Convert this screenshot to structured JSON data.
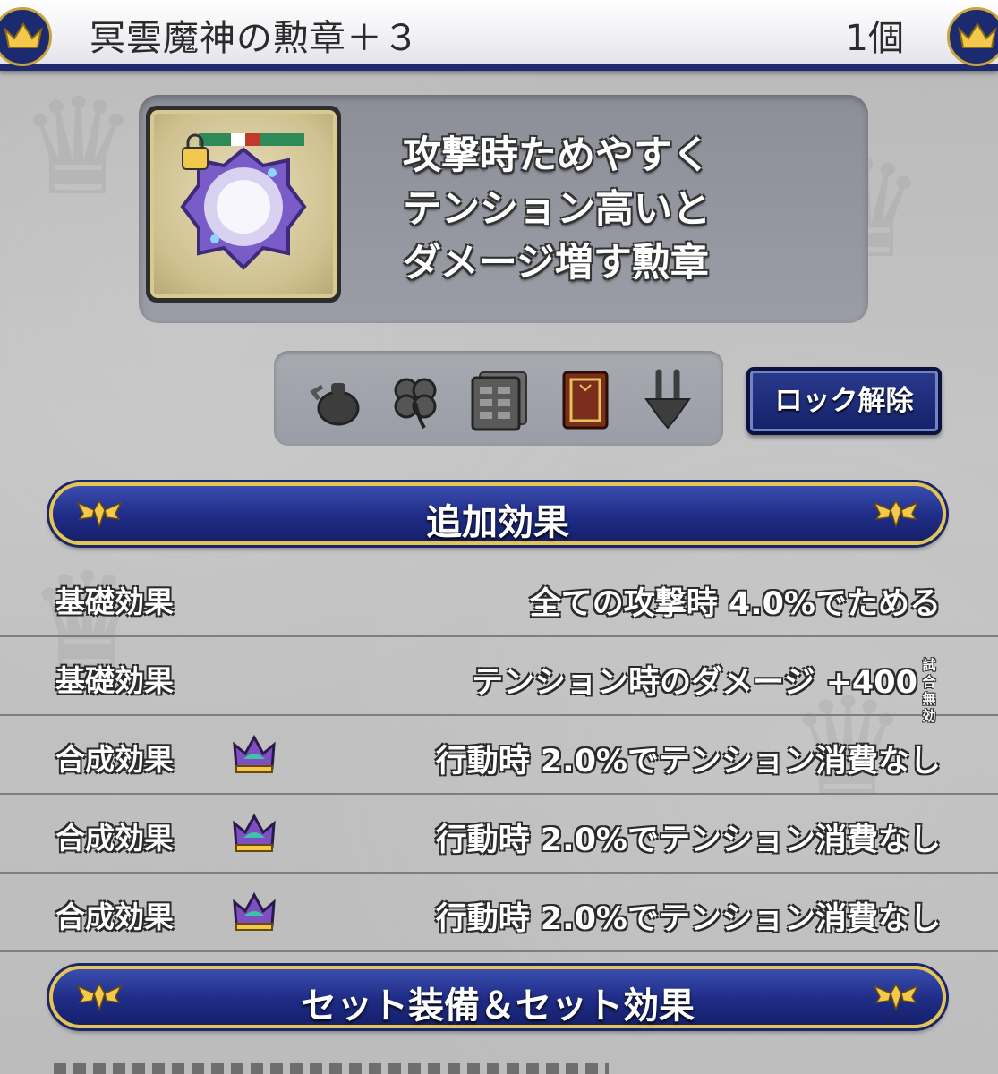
{
  "header": {
    "item_name": "冥雲魔神の勲章＋３",
    "count": "1個"
  },
  "item": {
    "description_lines": [
      "攻撃時ためやすく",
      "テンション高いと",
      "ダメージ増す勲章"
    ],
    "locked": true
  },
  "actions": {
    "icons": [
      "sell-bag-icon",
      "clover-icon",
      "storage-icon",
      "book-icon",
      "fork-icon"
    ],
    "unlock_label": "ロック解除"
  },
  "sections": {
    "additional_effects_title": "追加効果",
    "set_effects_title": "セット装備＆セット効果"
  },
  "effects": [
    {
      "label": "基礎効果",
      "value": "全ての攻撃時  4.0%でためる",
      "note": ""
    },
    {
      "label": "基礎効果",
      "value": "テンション時のダメージ  +400",
      "note": "試合無効"
    },
    {
      "label": "合成効果",
      "value": "行動時  2.0%でテンション消費なし",
      "note": ""
    },
    {
      "label": "合成効果",
      "value": "行動時  2.0%でテンション消費なし",
      "note": ""
    },
    {
      "label": "合成効果",
      "value": "行動時  2.0%でテンション消費なし",
      "note": ""
    }
  ],
  "colors": {
    "banner_blue": "#1f2c86",
    "banner_gold": "#e3c457",
    "header_border": "#1e2a6e"
  }
}
